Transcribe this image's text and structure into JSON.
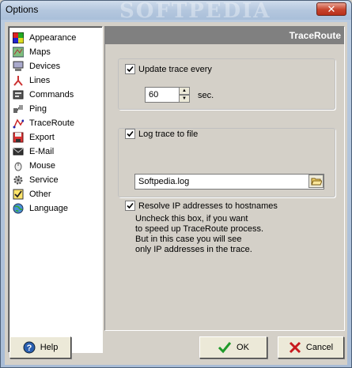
{
  "window": {
    "title": "Options",
    "watermark": "SOFTPEDIA",
    "close_glyph": "✕"
  },
  "nav": {
    "items": [
      {
        "label": "Appearance",
        "icon": "appearance-icon"
      },
      {
        "label": "Maps",
        "icon": "maps-icon"
      },
      {
        "label": "Devices",
        "icon": "devices-icon"
      },
      {
        "label": "Lines",
        "icon": "lines-icon"
      },
      {
        "label": "Commands",
        "icon": "commands-icon"
      },
      {
        "label": "Ping",
        "icon": "ping-icon"
      },
      {
        "label": "TraceRoute",
        "icon": "traceroute-icon"
      },
      {
        "label": "Export",
        "icon": "export-icon"
      },
      {
        "label": "E-Mail",
        "icon": "email-icon"
      },
      {
        "label": "Mouse",
        "icon": "mouse-icon"
      },
      {
        "label": "Service",
        "icon": "service-icon"
      },
      {
        "label": "Other",
        "icon": "other-icon"
      },
      {
        "label": "Language",
        "icon": "language-icon"
      }
    ],
    "selected": "TraceRoute"
  },
  "panel": {
    "header": "TraceRoute",
    "update_trace": {
      "label": "Update trace every",
      "checked": true,
      "value": "60",
      "unit": "sec."
    },
    "log_trace": {
      "label": "Log trace to file",
      "checked": true,
      "path": "Softpedia.log"
    },
    "resolve_ip": {
      "label": "Resolve IP addresses to hostnames",
      "checked": true,
      "note_lines": [
        "Uncheck this box, if you want",
        "to speed up TraceRoute process.",
        "But in this case you will see",
        "only IP addresses in the trace."
      ]
    }
  },
  "buttons": {
    "help": "Help",
    "ok": "OK",
    "cancel": "Cancel"
  },
  "colors": {
    "panel_header_bg": "#808080",
    "ok_check": "#1f9a2a",
    "cancel_x": "#c8191e",
    "help_icon_bg": "#2a5fb0"
  }
}
